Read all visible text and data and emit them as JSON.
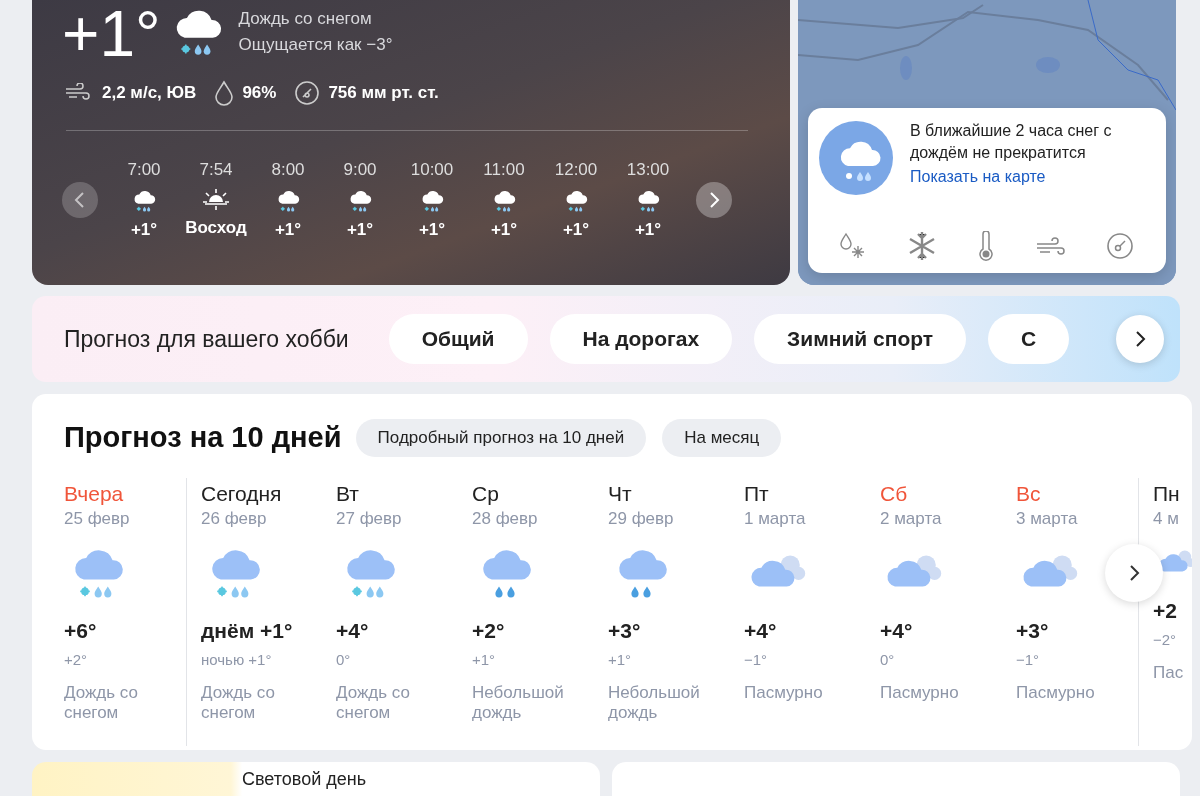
{
  "current": {
    "temp": "+1°",
    "condition": "Дождь со снегом",
    "feels_like": "Ощущается как −3°",
    "wind": "2,2 м/с, ЮВ",
    "humidity": "96%",
    "pressure": "756 мм рт. ст."
  },
  "hourly": [
    {
      "time": "7:00",
      "kind": "weather",
      "value": "+1°"
    },
    {
      "time": "7:54",
      "kind": "sunrise",
      "value": "Восход"
    },
    {
      "time": "8:00",
      "kind": "weather",
      "value": "+1°"
    },
    {
      "time": "9:00",
      "kind": "weather",
      "value": "+1°"
    },
    {
      "time": "10:00",
      "kind": "weather",
      "value": "+1°"
    },
    {
      "time": "11:00",
      "kind": "weather",
      "value": "+1°"
    },
    {
      "time": "12:00",
      "kind": "weather",
      "value": "+1°"
    },
    {
      "time": "13:00",
      "kind": "weather",
      "value": "+1°"
    }
  ],
  "nowcast": {
    "text": "В ближайшие 2 часа снег с дождём не прекратится",
    "link": "Показать на карте"
  },
  "hobby": {
    "title": "Прогноз для вашего хобби",
    "tabs": [
      "Общий",
      "На дорогах",
      "Зимний спорт",
      "С"
    ]
  },
  "forecast": {
    "title": "Прогноз на 10 дней",
    "buttons": [
      "Подробный прогноз на 10 дней",
      "На месяц"
    ],
    "days": [
      {
        "day": "Вчера",
        "date": "25 февр",
        "kind": "snow_rain",
        "temp_day": "+6°",
        "temp_night": "+2°",
        "condition": "Дождь со снегом",
        "accent": true,
        "divider_before": false
      },
      {
        "day": "Сегодня",
        "date": "26 февр",
        "kind": "snow_rain",
        "temp_day": "днём +1°",
        "temp_night": "ночью +1°",
        "condition": "Дождь со снегом",
        "accent": false,
        "divider_before": true
      },
      {
        "day": "Вт",
        "date": "27 февр",
        "kind": "snow_rain",
        "temp_day": "+4°",
        "temp_night": "0°",
        "condition": "Дождь со снегом",
        "accent": false,
        "divider_before": false
      },
      {
        "day": "Ср",
        "date": "28 февр",
        "kind": "rain",
        "temp_day": "+2°",
        "temp_night": "+1°",
        "condition": "Небольшой дождь",
        "accent": false,
        "divider_before": false
      },
      {
        "day": "Чт",
        "date": "29 февр",
        "kind": "rain",
        "temp_day": "+3°",
        "temp_night": "+1°",
        "condition": "Небольшой дождь",
        "accent": false,
        "divider_before": false
      },
      {
        "day": "Пт",
        "date": "1 марта",
        "kind": "cloudy",
        "temp_day": "+4°",
        "temp_night": "−1°",
        "condition": "Пасмурно",
        "accent": false,
        "divider_before": false
      },
      {
        "day": "Сб",
        "date": "2 марта",
        "kind": "cloudy",
        "temp_day": "+4°",
        "temp_night": "0°",
        "condition": "Пасмурно",
        "accent": true,
        "divider_before": false
      },
      {
        "day": "Вс",
        "date": "3 марта",
        "kind": "cloudy",
        "temp_day": "+3°",
        "temp_night": "−1°",
        "condition": "Пасмурно",
        "accent": true,
        "divider_before": false
      },
      {
        "day": "Пн",
        "date": "4 м",
        "kind": "cloudy",
        "temp_day": "+2",
        "temp_night": "−2°",
        "condition": "Пас",
        "accent": false,
        "divider_before": true
      }
    ]
  },
  "daylight": {
    "title": "Световой день"
  }
}
